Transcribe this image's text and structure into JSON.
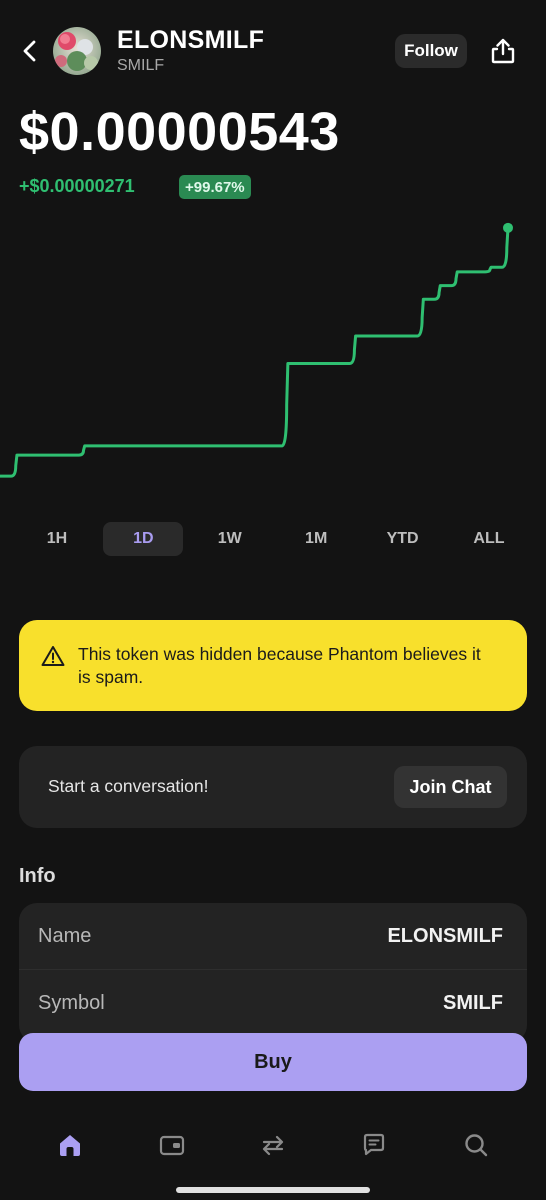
{
  "header": {
    "title": "ELONSMILF",
    "subtitle": "SMILF",
    "follow_label": "Follow",
    "icons": {
      "back": "chevron-left-icon",
      "share": "share-icon"
    }
  },
  "price": {
    "value": "$0.00000543",
    "change": "+$0.00000271",
    "change_pct": "+99.67%",
    "positive_color": "#2fbf71"
  },
  "chart_data": {
    "type": "line",
    "series": [
      {
        "values": [
          2.72,
          2.95,
          2.95,
          2.95,
          2.95,
          3.05,
          3.05,
          3.05,
          3.05,
          3.05,
          3.05,
          3.05,
          3.05,
          3.05,
          3.05,
          3.05,
          3.05,
          3.95,
          3.95,
          3.95,
          3.95,
          4.25,
          4.25,
          4.25,
          4.25,
          4.65,
          4.8,
          4.95,
          4.95,
          5.0,
          5.43
        ]
      }
    ],
    "color": "#2fbf71",
    "grid": false
  },
  "ranges": {
    "items": [
      "1H",
      "1D",
      "1W",
      "1M",
      "YTD",
      "ALL"
    ],
    "active": "1D"
  },
  "warning": {
    "text": "This token was hidden because Phantom believes it is spam.",
    "icon": "warning-icon",
    "color": "#f8e02c"
  },
  "chat": {
    "prompt": "Start a conversation!",
    "button_label": "Join Chat"
  },
  "info": {
    "title": "Info",
    "rows": [
      {
        "label": "Name",
        "value": "ELONSMILF"
      },
      {
        "label": "Symbol",
        "value": "SMILF"
      }
    ]
  },
  "buy_label": "Buy",
  "accent_color": "#ab9ff2",
  "nav": {
    "items": [
      "home-icon",
      "wallet-icon",
      "swap-icon",
      "chat-icon",
      "search-icon"
    ],
    "active": "home-icon"
  }
}
